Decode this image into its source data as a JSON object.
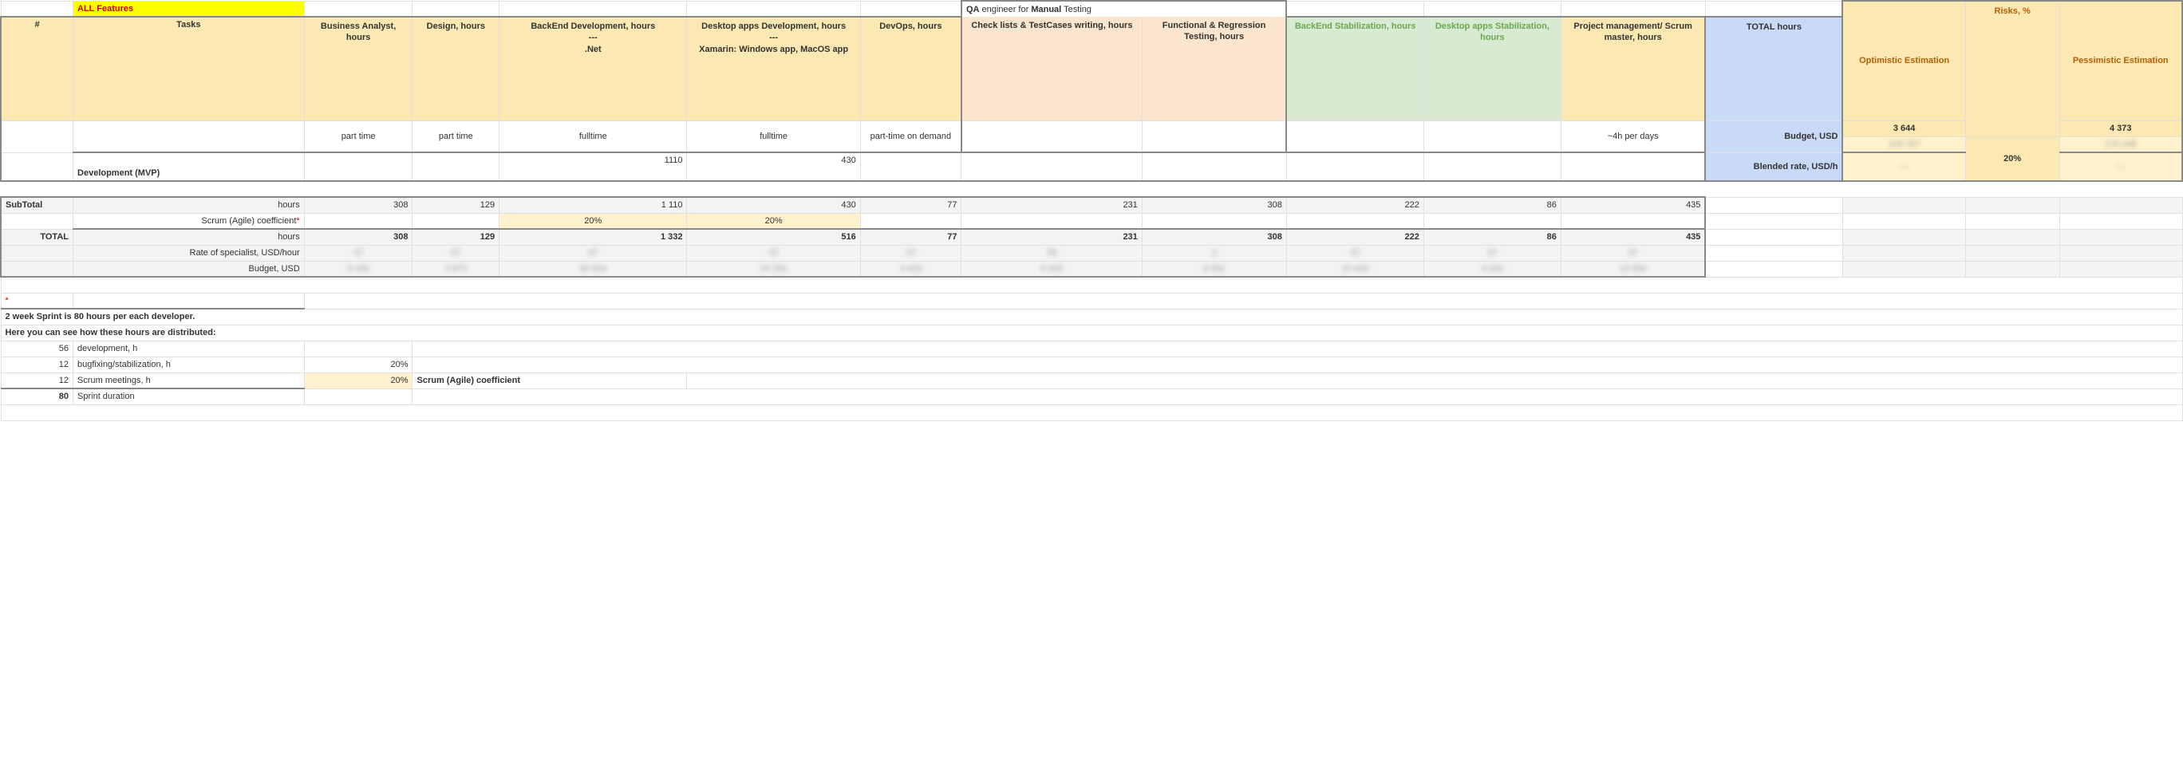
{
  "row_top": {
    "all_features": "ALL Features",
    "qa_prefix": "QA",
    "qa_mid": " engineer for ",
    "qa_manual": "Manual",
    "qa_suffix": " Testing",
    "opt_est": "Optimistic Estimation",
    "risks": "Risks, %",
    "pess_est": "Pessimistic Estimation"
  },
  "headers": {
    "num": "#",
    "tasks": "Tasks",
    "ba": "Business Analyst, hours",
    "design": "Design, hours",
    "backend": "BackEnd Development, hours\n---\n.Net",
    "desktop": "Desktop apps Development, hours\n---\nXamarin: Windows app, MacOS app",
    "devops": "DevOps, hours",
    "check": "Check lists & TestCases writing, hours",
    "func": "Functional & Regression Testing, hours",
    "bstab": "BackEnd Stabilization, hours",
    "dstab": "Desktop apps Stabilization, hours",
    "pm": "Project management/ Scrum master, hours",
    "total": "TOTAL hours"
  },
  "sums": {
    "opt_val": "3 644",
    "risk_val": "20%",
    "pess_val": "4 373"
  },
  "modes": {
    "ba": "part time",
    "design": "part time",
    "backend": "fulltime",
    "desktop": "fulltime",
    "devops": "part-time on demand",
    "pm": "~4h per days",
    "budget_label": "Budget, USD",
    "budget_opt_blur": "109 767",
    "budget_pess_blur": "170 248"
  },
  "dev_row": {
    "label": "Development (MVP)",
    "backend": "1110",
    "desktop": "430",
    "rate_label": "Blended rate, USD/h",
    "rate_opt_blur": "—",
    "rate_pess_blur": "—"
  },
  "subtotal": {
    "label": "SubTotal",
    "unit": "hours",
    "ba": "308",
    "design": "129",
    "backend": "1 110",
    "desktop": "430",
    "devops": "77",
    "check": "231",
    "func": "308",
    "bstab": "222",
    "dstab": "86",
    "pm": "435"
  },
  "scrum_coef": {
    "label": "Scrum (Agile) coefficient",
    "ast": "*",
    "backend": "20%",
    "desktop": "20%"
  },
  "total": {
    "label": "TOTAL",
    "unit": "hours",
    "ba": "308",
    "design": "129",
    "backend": "1 332",
    "desktop": "516",
    "devops": "77",
    "check": "231",
    "func": "308",
    "bstab": "222",
    "dstab": "86",
    "pm": "435"
  },
  "rate_row": {
    "label": "Rate of specialist, USD/hour"
  },
  "budget_row": {
    "label": "Budget, USD"
  },
  "note": {
    "ast": "*",
    "line1": "2 week Sprint is 80 hours per each developer.",
    "line2": "Here you can see how these hours are distributed:",
    "r1_val": "56",
    "r1_lbl": "development, h",
    "r2_val": "12",
    "r2_lbl": "bugfixing/stabilization, h",
    "r2_pct": "20%",
    "r3_val": "12",
    "r3_lbl": "Scrum meetings, h",
    "r3_pct": "20%",
    "r3_coef": "Scrum (Agile) coefficient",
    "r4_val": "80",
    "r4_lbl": "Sprint duration"
  }
}
